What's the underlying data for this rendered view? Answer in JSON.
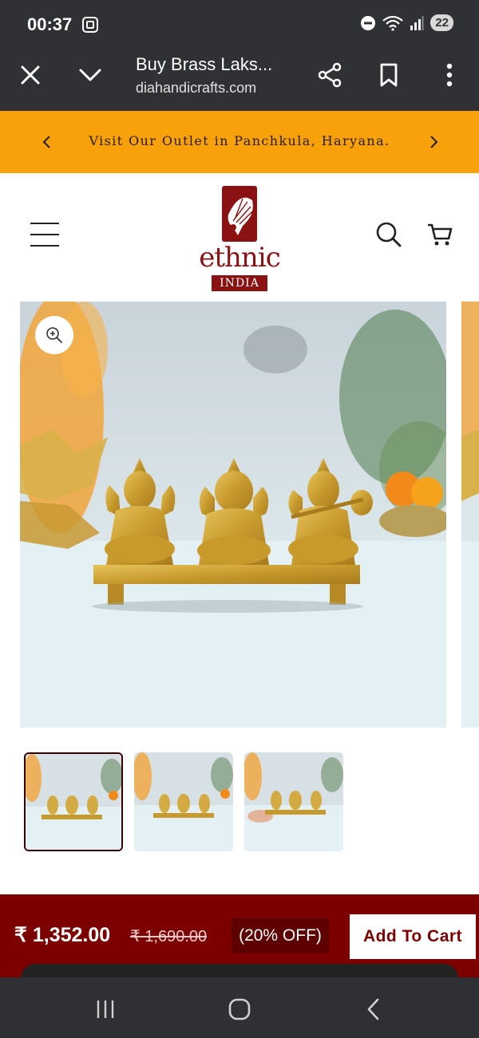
{
  "status_bar": {
    "time": "00:37",
    "battery_level": "22",
    "icons": [
      "screenshot-icon",
      "dnd-icon",
      "wifi-icon",
      "signal-icon",
      "battery-icon"
    ]
  },
  "browser": {
    "page_title": "Buy Brass Laks...",
    "url": "diahandicrafts.com",
    "icons": [
      "close-icon",
      "chevron-down-icon",
      "share-icon",
      "bookmark-icon",
      "more-vert-icon"
    ]
  },
  "announcement": {
    "text": "Visit Our Outlet in Panchkula, Haryana.",
    "background": "#f8a10a"
  },
  "header": {
    "logo_text": "ethnic",
    "logo_sub": "INDIA",
    "icons": [
      "menu-icon",
      "search-icon",
      "cart-icon"
    ]
  },
  "gallery": {
    "thumbnail_count": 3,
    "active_thumbnail": 1,
    "icons": [
      "zoom-in-icon"
    ]
  },
  "buy_bar": {
    "price": "₹ 1,352.00",
    "original_price": "₹ 1,690.00",
    "discount": "(20% OFF)",
    "add_to_cart": "Add To Cart",
    "background": "#7d0000"
  },
  "nav_bar": {
    "icons": [
      "recents-icon",
      "home-icon",
      "back-icon"
    ]
  }
}
